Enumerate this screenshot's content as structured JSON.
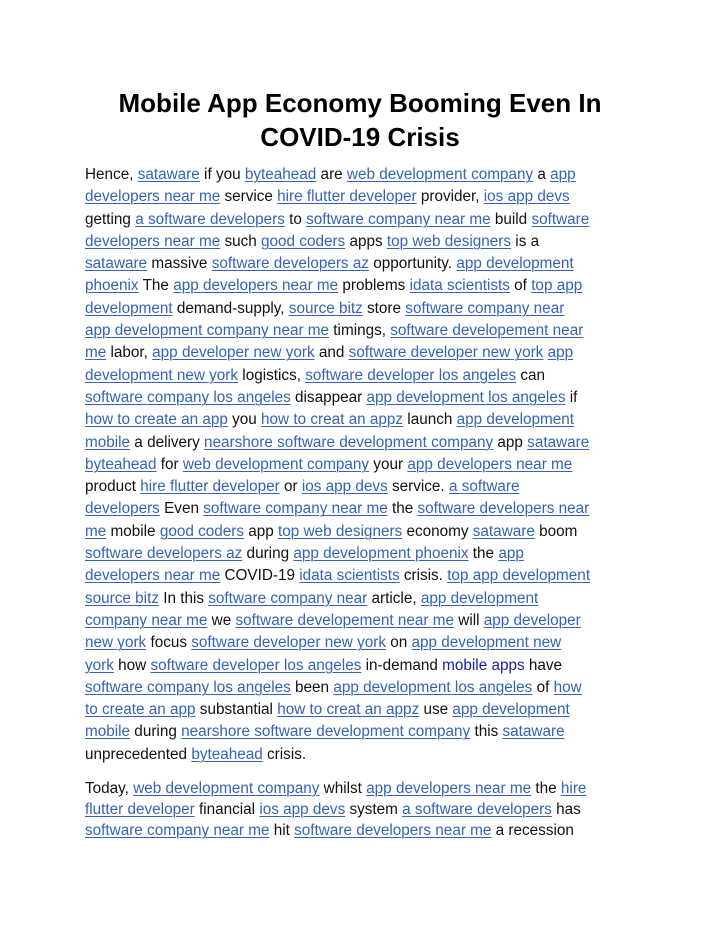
{
  "title": "Mobile App Economy Booming Even In COVID-19 Crisis",
  "title_lines": [
    "Mobile App Economy Booming Even In",
    "COVID-19 Crisis"
  ],
  "colors": {
    "link": "#3563b5",
    "text": "#111111",
    "highlight_text": "#1a1aa6"
  },
  "paragraphs": [
    {
      "lines": [
        [
          {
            "t": "Hence, "
          },
          {
            "l": "sataware"
          },
          {
            "t": " if you "
          },
          {
            "l": "byteahead"
          },
          {
            "t": " are "
          },
          {
            "l": "web development company"
          },
          {
            "t": " a "
          },
          {
            "l": "app"
          }
        ],
        [
          {
            "l": "developers near me"
          },
          {
            "t": " service "
          },
          {
            "l": "hire flutter developer"
          },
          {
            "t": " provider, "
          },
          {
            "l": "ios app devs"
          }
        ],
        [
          {
            "t": "getting "
          },
          {
            "l": "a software developers"
          },
          {
            "t": " to "
          },
          {
            "l": "software company near me"
          },
          {
            "t": " build "
          },
          {
            "l": "software"
          }
        ],
        [
          {
            "l": "developers near me"
          },
          {
            "t": " such "
          },
          {
            "l": "good coders"
          },
          {
            "t": " apps "
          },
          {
            "l": "top web designers"
          },
          {
            "t": " is a"
          }
        ],
        [
          {
            "l": "sataware"
          },
          {
            "t": " massive "
          },
          {
            "l": "software developers az"
          },
          {
            "t": " opportunity. "
          },
          {
            "l": "app development"
          }
        ],
        [
          {
            "l": "phoenix"
          },
          {
            "t": " The "
          },
          {
            "l": "app developers near me"
          },
          {
            "t": " problems "
          },
          {
            "l": "idata scientists"
          },
          {
            "t": " of "
          },
          {
            "l": "top app"
          }
        ],
        [
          {
            "l": "development"
          },
          {
            "t": " demand-supply, "
          },
          {
            "l": "source bitz"
          },
          {
            "t": " store "
          },
          {
            "l": "software company near"
          }
        ],
        [
          {
            "l": "app development company near me"
          },
          {
            "t": " timings, "
          },
          {
            "l": "software developement near"
          }
        ],
        [
          {
            "l": "me"
          },
          {
            "t": " labor, "
          },
          {
            "l": "app developer new york"
          },
          {
            "t": " and "
          },
          {
            "l": "software developer new york"
          },
          {
            "t": " "
          },
          {
            "l": "app"
          }
        ],
        [
          {
            "l": "development new york"
          },
          {
            "t": " logistics, "
          },
          {
            "l": "software developer los angeles"
          },
          {
            "t": " can"
          }
        ],
        [
          {
            "l": "software company los angeles"
          },
          {
            "t": " disappear "
          },
          {
            "l": "app development los angeles"
          },
          {
            "t": " if"
          }
        ],
        [
          {
            "l": "how to create an app"
          },
          {
            "t": " you "
          },
          {
            "l": "how to creat an appz"
          },
          {
            "t": " launch "
          },
          {
            "l": "app development"
          }
        ],
        [
          {
            "l": "mobile"
          },
          {
            "t": " a delivery "
          },
          {
            "l": "nearshore software development company"
          },
          {
            "t": " app "
          },
          {
            "l": "sataware"
          }
        ],
        [
          {
            "l": "byteahead"
          },
          {
            "t": " for "
          },
          {
            "l": "web development company"
          },
          {
            "t": " your "
          },
          {
            "l": "app developers near me"
          }
        ],
        [
          {
            "t": "product "
          },
          {
            "l": "hire flutter developer"
          },
          {
            "t": " or "
          },
          {
            "l": "ios app devs"
          },
          {
            "t": " service. "
          },
          {
            "l": "a software"
          }
        ],
        [
          {
            "l": "developers"
          },
          {
            "t": " Even "
          },
          {
            "l": "software company near me"
          },
          {
            "t": " the "
          },
          {
            "l": "software developers near"
          }
        ],
        [
          {
            "l": "me"
          },
          {
            "t": " mobile "
          },
          {
            "l": "good coders"
          },
          {
            "t": " app "
          },
          {
            "l": "top web designers"
          },
          {
            "t": " economy "
          },
          {
            "l": "sataware"
          },
          {
            "t": " boom"
          }
        ],
        [
          {
            "l": "software developers az"
          },
          {
            "t": " during "
          },
          {
            "l": "app development phoenix"
          },
          {
            "t": " the "
          },
          {
            "l": "app"
          }
        ],
        [
          {
            "l": "developers near me"
          },
          {
            "t": " COVID-19 "
          },
          {
            "l": "idata scientists"
          },
          {
            "t": " crisis. "
          },
          {
            "l": "top app development"
          }
        ],
        [
          {
            "l": "source bitz"
          },
          {
            "t": " In this "
          },
          {
            "l": "software company near"
          },
          {
            "t": " article, "
          },
          {
            "l": "app development"
          }
        ],
        [
          {
            "l": "company near me"
          },
          {
            "t": " we "
          },
          {
            "l": "software developement near me"
          },
          {
            "t": " will "
          },
          {
            "l": "app developer"
          }
        ],
        [
          {
            "l": "new york"
          },
          {
            "t": " focus "
          },
          {
            "l": "software developer new york"
          },
          {
            "t": " on "
          },
          {
            "l": "app development new"
          }
        ],
        [
          {
            "l": "york"
          },
          {
            "t": " how "
          },
          {
            "l": "software developer los angeles"
          },
          {
            "t": " in-demand "
          },
          {
            "h": "mobile apps"
          },
          {
            "t": " have"
          }
        ],
        [
          {
            "l": "software company los angeles"
          },
          {
            "t": " been "
          },
          {
            "l": "app development los angeles"
          },
          {
            "t": " of "
          },
          {
            "l": "how"
          }
        ],
        [
          {
            "l": "to create an app"
          },
          {
            "t": " substantial "
          },
          {
            "l": "how to creat an appz"
          },
          {
            "t": " use "
          },
          {
            "l": "app development"
          }
        ],
        [
          {
            "l": "mobile"
          },
          {
            "t": " during "
          },
          {
            "l": "nearshore software development company"
          },
          {
            "t": " this "
          },
          {
            "l": "sataware"
          }
        ],
        [
          {
            "t": "unprecedented "
          },
          {
            "l": "byteahead"
          },
          {
            "t": " crisis."
          }
        ]
      ]
    },
    {
      "lines": [
        [
          {
            "t": "Today, "
          },
          {
            "l": "web development company"
          },
          {
            "t": " whilst "
          },
          {
            "l": "app developers near me"
          },
          {
            "t": " the "
          },
          {
            "l": "hire"
          }
        ],
        [
          {
            "l": "flutter developer"
          },
          {
            "t": " financial "
          },
          {
            "l": "ios app devs"
          },
          {
            "t": " system "
          },
          {
            "l": "a software developers"
          },
          {
            "t": " has"
          }
        ],
        [
          {
            "l": "software company near me"
          },
          {
            "t": " hit "
          },
          {
            "l": "software developers near me"
          },
          {
            "t": " a recession"
          }
        ]
      ]
    }
  ]
}
